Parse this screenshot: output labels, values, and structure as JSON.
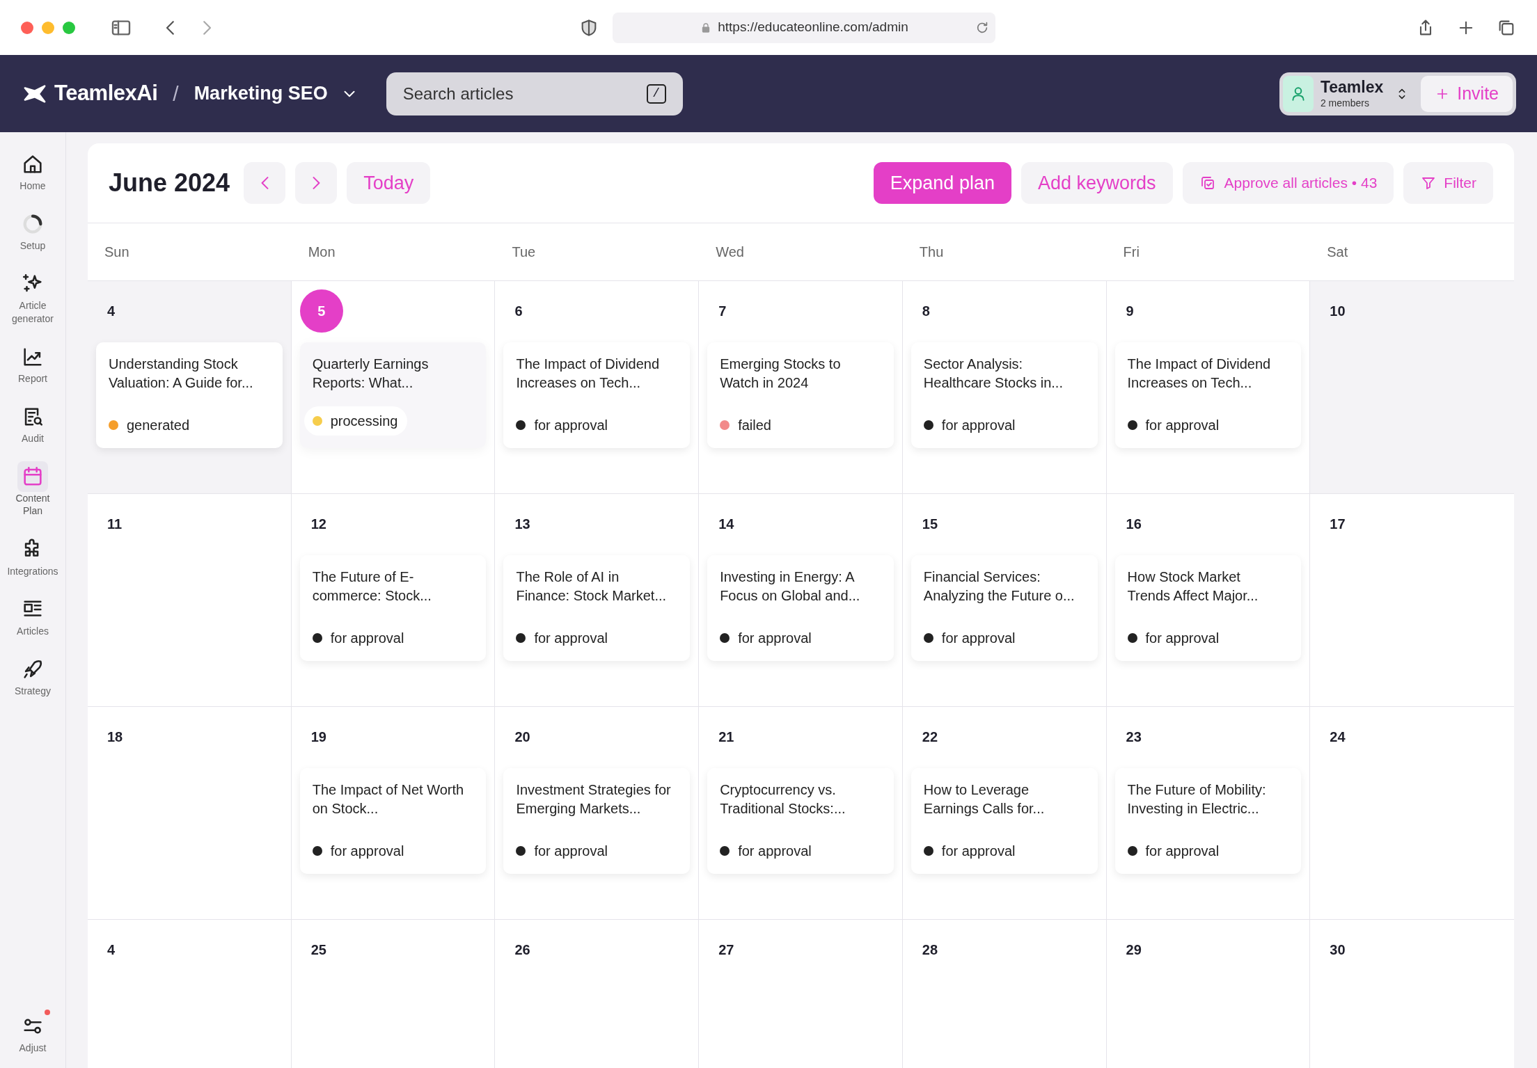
{
  "browser": {
    "url": "https://educateonline.com/admin"
  },
  "topbar": {
    "brand": "TeamlexAi",
    "separator": "/",
    "project": "Marketing SEO",
    "search": {
      "placeholder": "Search articles",
      "shortcut": "/"
    },
    "team": {
      "name": "Teamlex",
      "members": "2 members"
    },
    "invite": "Invite"
  },
  "sidebar": {
    "items": [
      {
        "label": "Home",
        "selected": false,
        "notification": false
      },
      {
        "label": "Setup",
        "selected": false,
        "notification": false
      },
      {
        "label": "Article generator",
        "selected": false,
        "notification": false
      },
      {
        "label": "Report",
        "selected": false,
        "notification": false
      },
      {
        "label": "Audit",
        "selected": false,
        "notification": false
      },
      {
        "label": "Content Plan",
        "selected": true,
        "notification": false
      },
      {
        "label": "Integrations",
        "selected": false,
        "notification": false
      },
      {
        "label": "Articles",
        "selected": false,
        "notification": false
      },
      {
        "label": "Strategy",
        "selected": false,
        "notification": false
      }
    ],
    "bottom": {
      "label": "Adjust",
      "selected": false,
      "notification": true
    }
  },
  "calendar": {
    "title": "June 2024",
    "today_button": "Today",
    "actions": {
      "expand": "Expand plan",
      "keywords": "Add keywords",
      "approve": "Approve all articles • 43",
      "filter": "Filter"
    },
    "weekdays": [
      "Sun",
      "Mon",
      "Tue",
      "Wed",
      "Thu",
      "Fri",
      "Sat"
    ],
    "weeks": [
      [
        {
          "day": "4",
          "today": false,
          "shaded": true,
          "article": {
            "title": "Understanding Stock Valuation: A Guide for...",
            "status": "generated",
            "kind": "generated",
            "color": "#f59e2b"
          }
        },
        {
          "day": "5",
          "today": true,
          "shaded": false,
          "article": {
            "title": "Quarterly Earnings Reports: What...",
            "status": "processing",
            "kind": "processing",
            "color": "#f6cd4c"
          }
        },
        {
          "day": "6",
          "today": false,
          "shaded": false,
          "article": {
            "title": "The Impact of Dividend Increases on Tech...",
            "status": "for approval",
            "kind": "approval",
            "color": "#222222"
          }
        },
        {
          "day": "7",
          "today": false,
          "shaded": false,
          "article": {
            "title": "Emerging Stocks to Watch in 2024",
            "status": "failed",
            "kind": "failed",
            "color": "#f28a8a"
          }
        },
        {
          "day": "8",
          "today": false,
          "shaded": false,
          "article": {
            "title": "Sector Analysis: Healthcare Stocks in...",
            "status": "for approval",
            "kind": "approval",
            "color": "#222222"
          }
        },
        {
          "day": "9",
          "today": false,
          "shaded": false,
          "article": {
            "title": "The Impact of Dividend Increases on Tech...",
            "status": "for approval",
            "kind": "approval",
            "color": "#222222"
          }
        },
        {
          "day": "10",
          "today": false,
          "shaded": true
        }
      ],
      [
        {
          "day": "11",
          "today": false,
          "shaded": false
        },
        {
          "day": "12",
          "today": false,
          "shaded": false,
          "article": {
            "title": "The Future of E-commerce: Stock...",
            "status": "for approval",
            "kind": "approval",
            "color": "#222222"
          }
        },
        {
          "day": "13",
          "today": false,
          "shaded": false,
          "article": {
            "title": "The Role of AI in Finance: Stock Market...",
            "status": "for approval",
            "kind": "approval",
            "color": "#222222"
          }
        },
        {
          "day": "14",
          "today": false,
          "shaded": false,
          "article": {
            "title": "Investing in Energy: A Focus on Global and...",
            "status": "for approval",
            "kind": "approval",
            "color": "#222222"
          }
        },
        {
          "day": "15",
          "today": false,
          "shaded": false,
          "article": {
            "title": "Financial Services: Analyzing the Future o...",
            "status": "for approval",
            "kind": "approval",
            "color": "#222222"
          }
        },
        {
          "day": "16",
          "today": false,
          "shaded": false,
          "article": {
            "title": "How Stock Market Trends Affect Major...",
            "status": "for approval",
            "kind": "approval",
            "color": "#222222"
          }
        },
        {
          "day": "17",
          "today": false,
          "shaded": false
        }
      ],
      [
        {
          "day": "18",
          "today": false,
          "shaded": false
        },
        {
          "day": "19",
          "today": false,
          "shaded": false,
          "article": {
            "title": "The Impact of Net Worth on Stock...",
            "status": "for approval",
            "kind": "approval",
            "color": "#222222"
          }
        },
        {
          "day": "20",
          "today": false,
          "shaded": false,
          "article": {
            "title": "Investment Strategies for Emerging Markets...",
            "status": "for approval",
            "kind": "approval",
            "color": "#222222"
          }
        },
        {
          "day": "21",
          "today": false,
          "shaded": false,
          "article": {
            "title": "Cryptocurrency vs. Traditional Stocks:...",
            "status": "for approval",
            "kind": "approval",
            "color": "#222222"
          }
        },
        {
          "day": "22",
          "today": false,
          "shaded": false,
          "article": {
            "title": "How to Leverage Earnings Calls for...",
            "status": "for approval",
            "kind": "approval",
            "color": "#222222"
          }
        },
        {
          "day": "23",
          "today": false,
          "shaded": false,
          "article": {
            "title": "The Future of Mobility: Investing in Electric...",
            "status": "for approval",
            "kind": "approval",
            "color": "#222222"
          }
        },
        {
          "day": "24",
          "today": false,
          "shaded": false
        }
      ],
      [
        {
          "day": "4",
          "today": false,
          "shaded": false
        },
        {
          "day": "25",
          "today": false,
          "shaded": false
        },
        {
          "day": "26",
          "today": false,
          "shaded": false
        },
        {
          "day": "27",
          "today": false,
          "shaded": false
        },
        {
          "day": "28",
          "today": false,
          "shaded": false
        },
        {
          "day": "29",
          "today": false,
          "shaded": false
        },
        {
          "day": "30",
          "today": false,
          "shaded": false
        }
      ]
    ]
  }
}
